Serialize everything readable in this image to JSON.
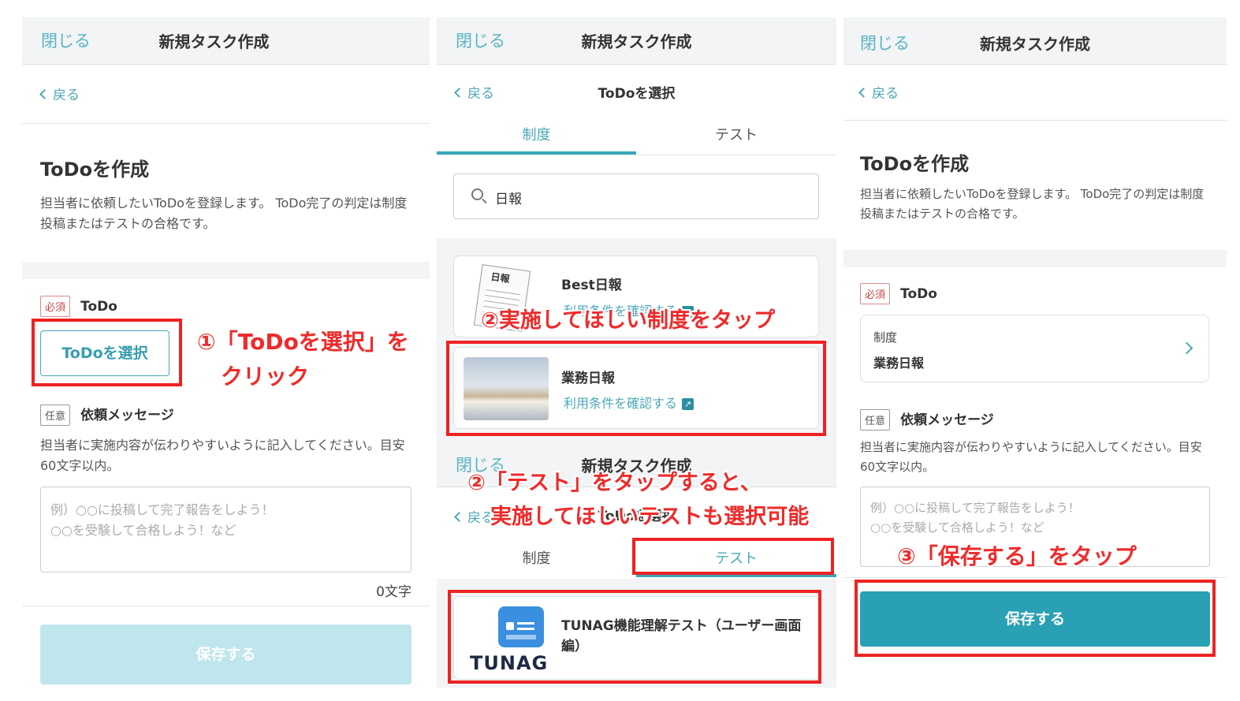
{
  "panel1": {
    "close": "閉じる",
    "title": "新規タスク作成",
    "back": "戻る",
    "heading": "ToDoを作成",
    "description": "担当者に依頼したいToDoを登録します。 ToDo完了の判定は制度投稿またはテストの合格です。",
    "required_tag": "必須",
    "todo_label": "ToDo",
    "select_button": "ToDoを選択",
    "optional_tag": "任意",
    "message_label": "依頼メッセージ",
    "message_help": "担当者に実施内容が伝わりやすいように記入してください。目安60文字以内。",
    "placeholder": "例）○○に投稿して完了報告をしよう！\n○○を受験して合格しよう！など",
    "char_count": "0文字",
    "save_button": "保存する"
  },
  "panel2": {
    "close": "閉じる",
    "title": "新規タスク作成",
    "back": "戻る",
    "subtitle": "ToDoを選択",
    "tab_system": "制度",
    "tab_test": "テスト",
    "search_value": "日報",
    "item1_title": "Best日報",
    "item1_link": "利用条件を確認する",
    "item1_thumb_text": "日報",
    "item2_title": "業務日報",
    "item2_link": "利用条件を確認する"
  },
  "panel2b": {
    "close": "閉じる",
    "title": "新規タスク作成",
    "back": "戻る",
    "subtitle": "ToDoを選択",
    "tab_system": "制度",
    "tab_test": "テスト",
    "test_item_title": "TUNAG機能理解テスト（ユーザー画面編）",
    "logo_text": "TUNAG"
  },
  "panel3": {
    "close": "閉じる",
    "title": "新規タスク作成",
    "back": "戻る",
    "heading": "ToDoを作成",
    "description": "担当者に依頼したいToDoを登録します。 ToDo完了の判定は制度投稿またはテストの合格です。",
    "required_tag": "必須",
    "todo_label": "ToDo",
    "selected_type": "制度",
    "selected_name": "業務日報",
    "optional_tag": "任意",
    "message_label": "依頼メッセージ",
    "message_help": "担当者に実施内容が伝わりやすいように記入してください。目安60文字以内。",
    "placeholder": "例）○○に投稿して完了報告をしよう！\n○○を受験して合格しよう！など",
    "save_button": "保存する"
  },
  "annotations": {
    "step1_line1": "①「ToDoを選択」を",
    "step1_line2": "クリック",
    "step2a": "②実施してほしい制度をタップ",
    "step2b_line1": "②「テスト」をタップすると、",
    "step2b_line2": "実施してほしいテストも選択可能",
    "step3": "③「保存する」をタップ"
  },
  "colors": {
    "accent": "#4aa7b8",
    "save_enabled": "#2aa0b5",
    "save_disabled": "#bfe6ec",
    "annotation_red": "#ee2222",
    "header_bg": "#f2f4f5"
  }
}
